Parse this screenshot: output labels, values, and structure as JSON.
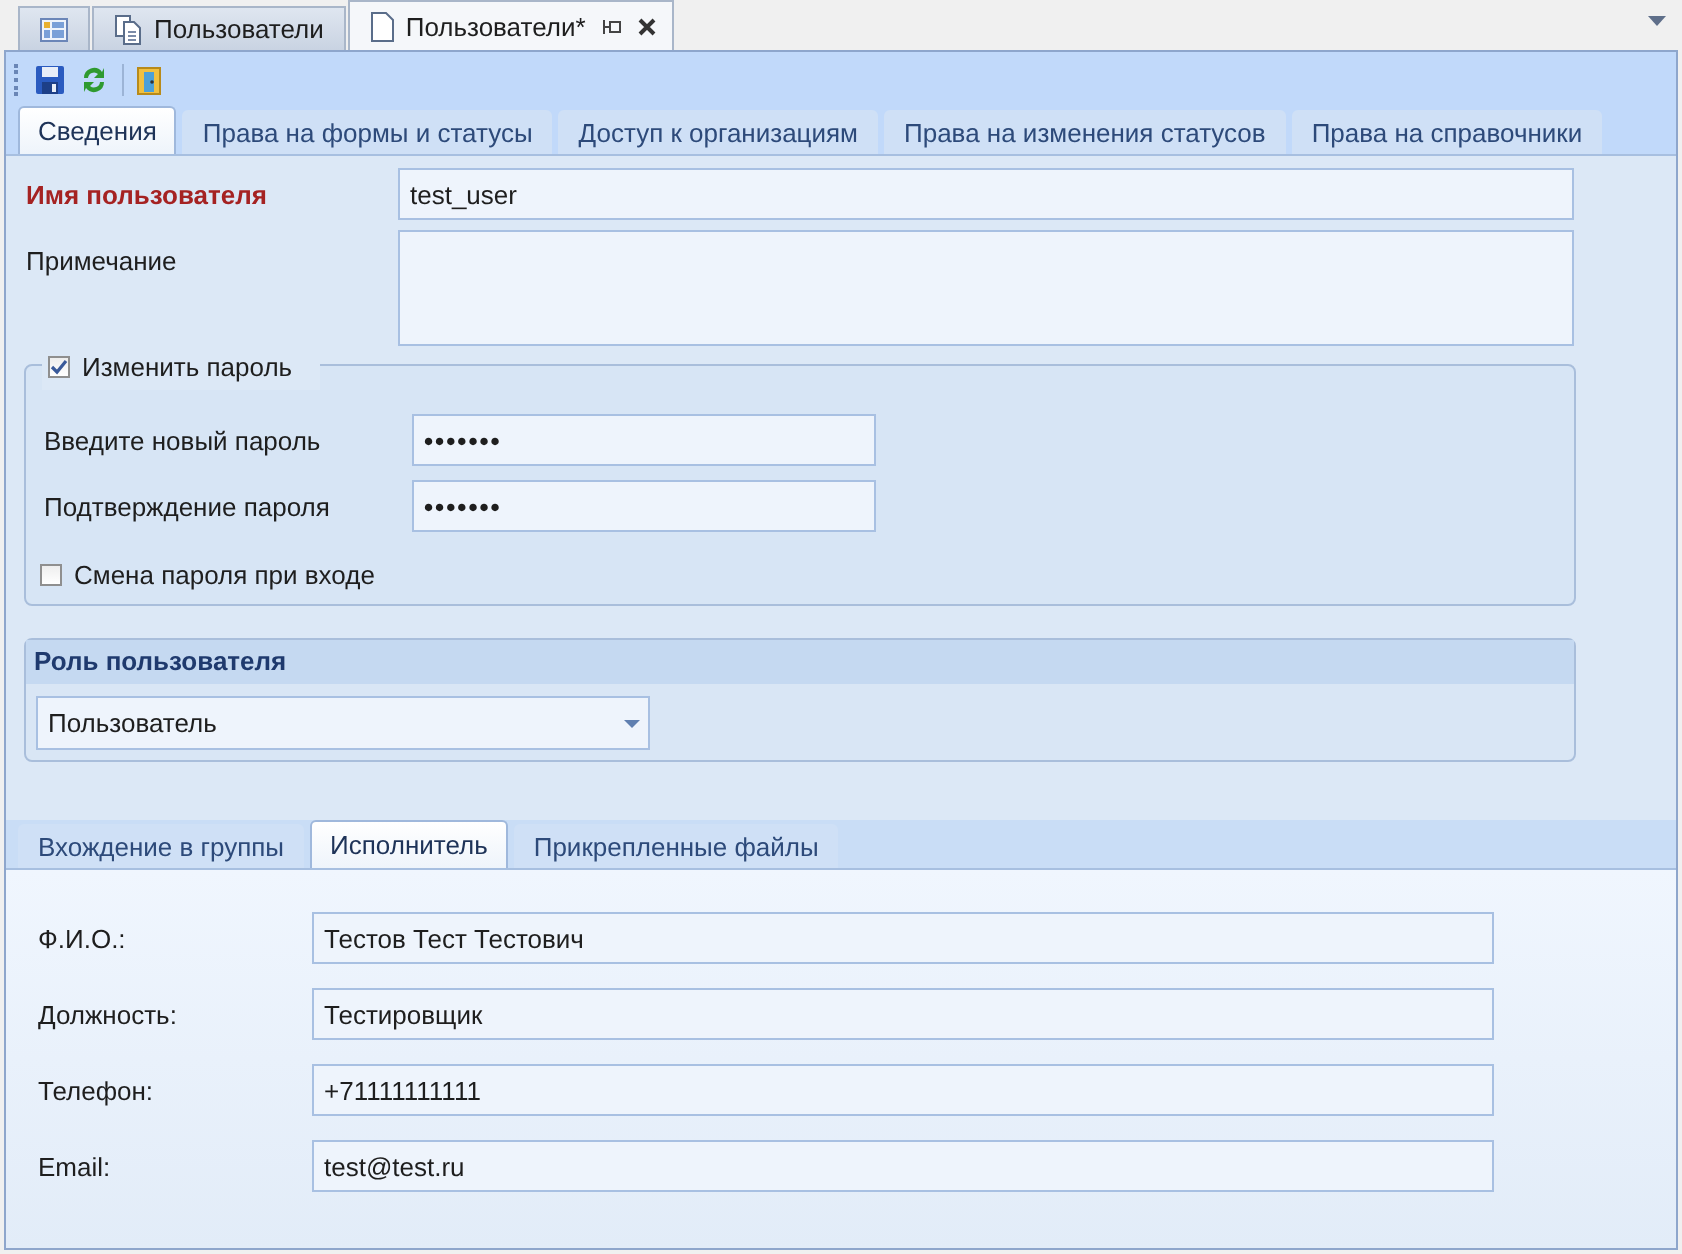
{
  "document_tabs": [
    {
      "kind": "grid",
      "selected": false
    },
    {
      "label": "Пользователи",
      "kind": "pages",
      "selected": false
    },
    {
      "label": "Пользователи*",
      "kind": "page",
      "selected": true
    }
  ],
  "toolbar": [
    {
      "kind": "save"
    },
    {
      "kind": "refresh"
    },
    {
      "kind": "exit"
    }
  ],
  "tabs": [
    {
      "label": "Сведения",
      "selected": true
    },
    {
      "label": "Права на формы и статусы",
      "selected": false
    },
    {
      "label": "Доступ к организациям",
      "selected": false
    },
    {
      "label": "Права на изменения статусов",
      "selected": false
    },
    {
      "label": "Права на справочники",
      "selected": false
    }
  ],
  "username": {
    "label": "Имя пользователя",
    "value": "test_user"
  },
  "note": {
    "label": "Примечание"
  },
  "password_group": {
    "label": "Изменить пароль",
    "checked": true,
    "fields": [
      {
        "label": "Введите новый пароль",
        "value": "•••••••"
      },
      {
        "label": "Подтверждение пароля",
        "value": "•••••••"
      }
    ],
    "change_on_login": {
      "label": "Смена пароля при входе",
      "checked": false
    }
  },
  "role_group": {
    "title": "Роль пользователя",
    "value": "Пользователь"
  },
  "sub_tabs": [
    {
      "label": "Вхождение в группы",
      "selected": false
    },
    {
      "label": "Исполнитель",
      "selected": true
    },
    {
      "label": "Прикрепленные файлы",
      "selected": false
    }
  ],
  "performer_fields": [
    {
      "label": "Ф.И.О.:",
      "value": "Тестов Тест Тестович"
    },
    {
      "label": "Должность:",
      "value": "Тестировщик"
    },
    {
      "label": "Телефон:",
      "value": "+71111111111"
    },
    {
      "label": "Email:",
      "value": "test@test.ru"
    }
  ]
}
